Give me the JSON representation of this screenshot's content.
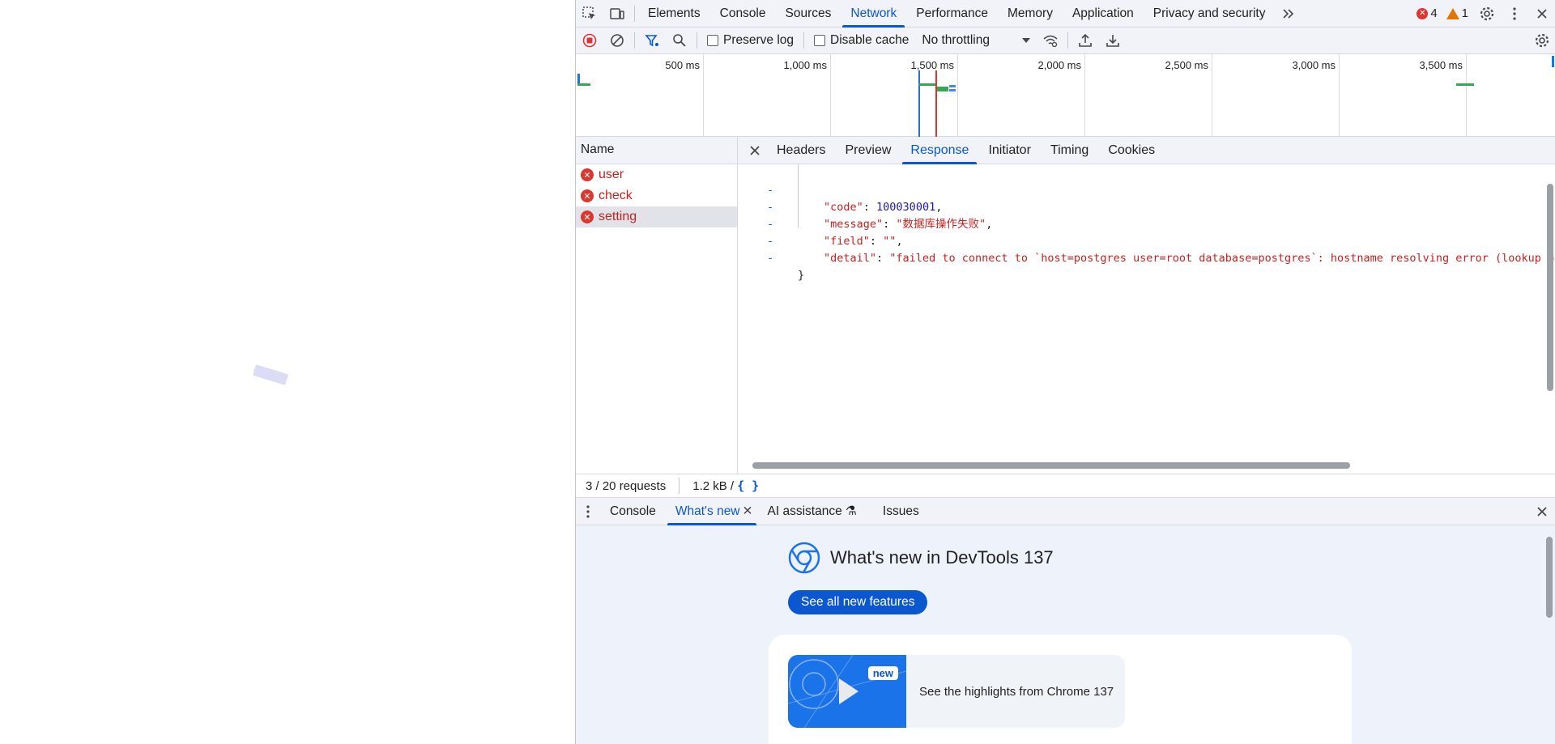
{
  "main_tabs": [
    "Elements",
    "Console",
    "Sources",
    "Network",
    "Performance",
    "Memory",
    "Application",
    "Privacy and security"
  ],
  "active_main_tab": "Network",
  "counts": {
    "errors": "4",
    "warnings": "1"
  },
  "toolbar": {
    "preserve_log": "Preserve log",
    "disable_cache": "Disable cache",
    "throttling": "No throttling"
  },
  "timeline": {
    "ticks": [
      "500 ms",
      "1,000 ms",
      "1,500 ms",
      "2,000 ms",
      "2,500 ms",
      "3,000 ms",
      "3,500 ms"
    ]
  },
  "name_column": {
    "header": "Name"
  },
  "requests": [
    {
      "name": "user",
      "status": "error"
    },
    {
      "name": "check",
      "status": "error"
    },
    {
      "name": "setting",
      "status": "error"
    }
  ],
  "detail_tabs": [
    "Headers",
    "Preview",
    "Response",
    "Initiator",
    "Timing",
    "Cookies"
  ],
  "active_detail_tab": "Response",
  "response": {
    "code_key": "\"code\"",
    "code_val": "100030001",
    "message_key": "\"message\"",
    "message_val": "\"数据库操作失败\"",
    "field_key": "\"field\"",
    "field_val": "\"\"",
    "detail_key": "\"detail\"",
    "detail_val": "\"failed to connect to `host=postgres user=root database=postgres`: hostname resolving error (lookup postgres",
    "close_brace": "}",
    "gutter_mark": "-"
  },
  "status_bar": {
    "requests": "3 / 20 requests",
    "size": "1.2 kB /",
    "format_icon": "{ }"
  },
  "drawer_tabs": [
    "Console",
    "What's new",
    "AI assistance",
    "Issues"
  ],
  "active_drawer_tab": "What's new",
  "whats_new": {
    "heading": "What's new in DevTools 137",
    "button": "See all new features",
    "badge": "new",
    "video_text": "See the highlights from Chrome 137"
  },
  "colors": {
    "accent": "#0b57d0",
    "error": "#dc362e",
    "warning": "#e37400",
    "panel_bg": "#f1f3f9"
  }
}
